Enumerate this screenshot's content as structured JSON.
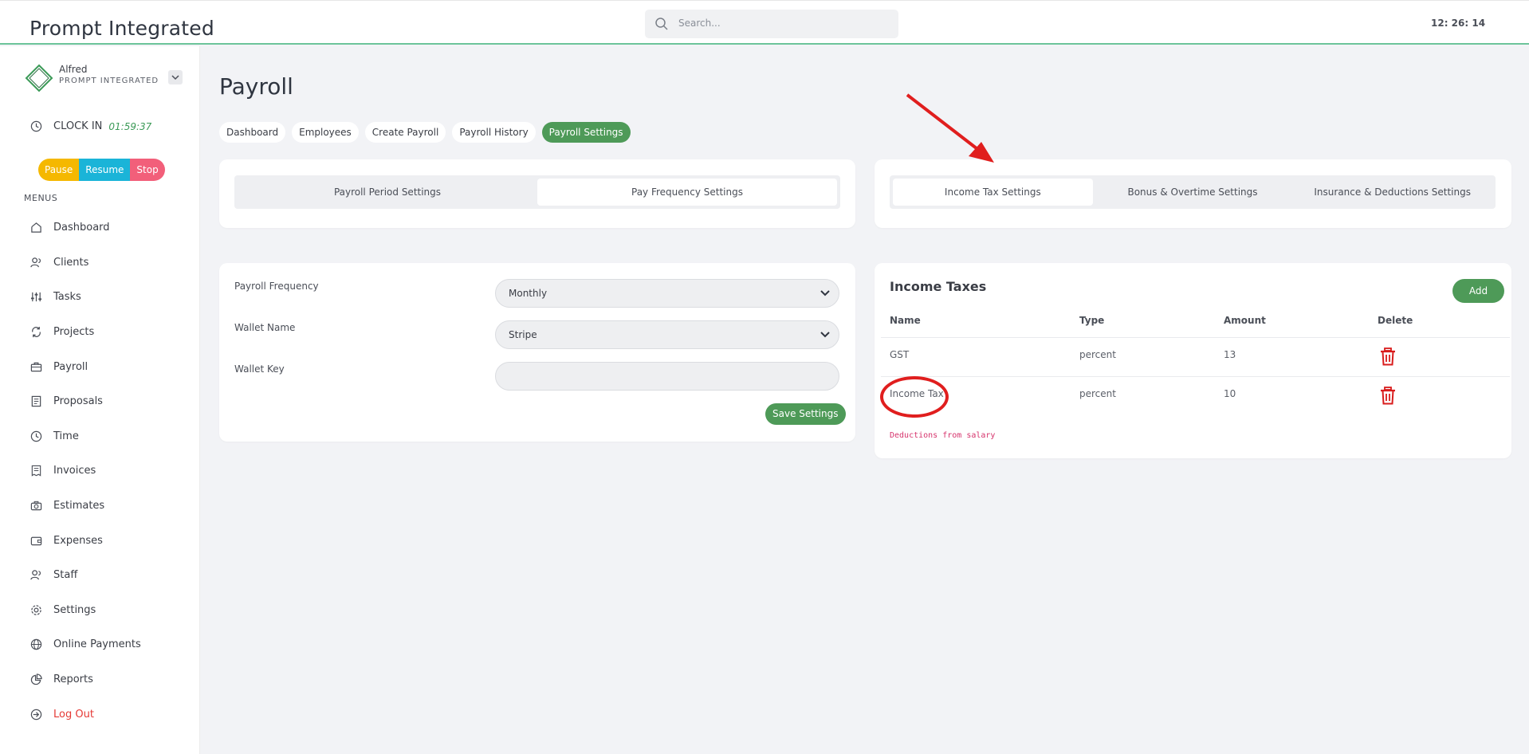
{
  "header": {
    "brand": "Prompt Integrated",
    "search_placeholder": "Search...",
    "clock": "12: 26: 14"
  },
  "sidebar": {
    "user_name": "Alfred",
    "user_org": "PROMPT INTEGRATED",
    "clock_in_label": "CLOCK IN",
    "clock_in_timer": "01:59:37",
    "timer_buttons": {
      "pause": "Pause",
      "resume": "Resume",
      "stop": "Stop"
    },
    "menus_label": "MENUS",
    "items": [
      {
        "label": "Dashboard",
        "icon": "home-icon"
      },
      {
        "label": "Clients",
        "icon": "users-icon"
      },
      {
        "label": "Tasks",
        "icon": "sliders-icon"
      },
      {
        "label": "Projects",
        "icon": "refresh-icon"
      },
      {
        "label": "Payroll",
        "icon": "briefcase-icon"
      },
      {
        "label": "Proposals",
        "icon": "document-icon"
      },
      {
        "label": "Time",
        "icon": "clock-icon"
      },
      {
        "label": "Invoices",
        "icon": "invoice-icon"
      },
      {
        "label": "Estimates",
        "icon": "camera-icon"
      },
      {
        "label": "Expenses",
        "icon": "wallet-icon"
      },
      {
        "label": "Staff",
        "icon": "users-icon"
      },
      {
        "label": "Settings",
        "icon": "gear-icon"
      },
      {
        "label": "Online Payments",
        "icon": "globe-icon"
      },
      {
        "label": "Reports",
        "icon": "pie-chart-icon"
      },
      {
        "label": "Log Out",
        "icon": "logout-icon"
      }
    ]
  },
  "main": {
    "title": "Payroll",
    "tabs": [
      "Dashboard",
      "Employees",
      "Create Payroll",
      "Payroll History",
      "Payroll Settings"
    ],
    "active_tab": "Payroll Settings",
    "left_segments": [
      "Payroll Period Settings",
      "Pay Frequency Settings"
    ],
    "right_segments": [
      "Income Tax Settings",
      "Bonus & Overtime Settings",
      "Insurance & Deductions Settings"
    ],
    "form": {
      "payroll_frequency_label": "Payroll Frequency",
      "payroll_frequency_value": "Monthly",
      "wallet_name_label": "Wallet Name",
      "wallet_name_value": "Stripe",
      "wallet_key_label": "Wallet Key",
      "wallet_key_value": "",
      "save_label": "Save Settings"
    },
    "income_taxes": {
      "title": "Income Taxes",
      "add_label": "Add",
      "columns": [
        "Name",
        "Type",
        "Amount",
        "Delete"
      ],
      "rows": [
        {
          "name": "GST",
          "type": "percent",
          "amount": "13"
        },
        {
          "name": "Income Tax",
          "type": "percent",
          "amount": "10"
        }
      ],
      "note": "Deductions from salary"
    }
  },
  "colors": {
    "accent": "#4e9a58",
    "annotation": "#e01e1e"
  }
}
